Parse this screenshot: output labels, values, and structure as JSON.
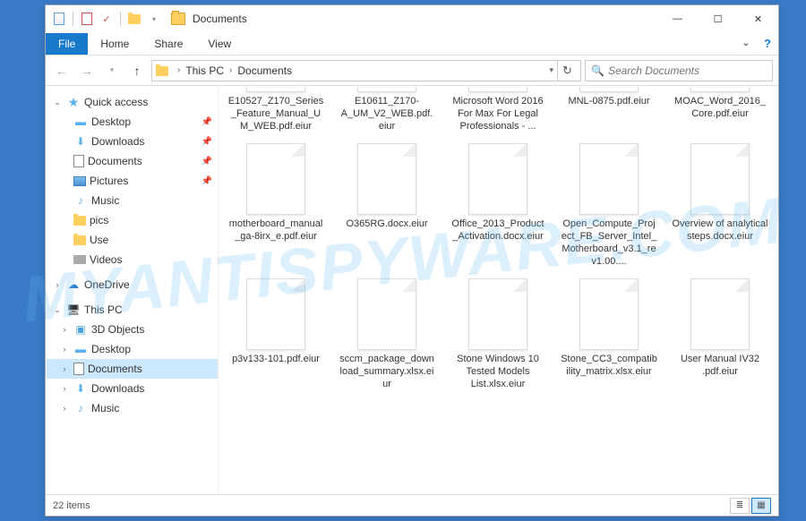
{
  "window": {
    "title": "Documents"
  },
  "ribbon": {
    "file": "File",
    "tabs": [
      "Home",
      "Share",
      "View"
    ]
  },
  "breadcrumb": {
    "root": "This PC",
    "current": "Documents"
  },
  "search": {
    "placeholder": "Search Documents"
  },
  "sidebar": {
    "quick_access": {
      "label": "Quick access",
      "items": [
        {
          "label": "Desktop",
          "pinned": true
        },
        {
          "label": "Downloads",
          "pinned": true
        },
        {
          "label": "Documents",
          "pinned": true
        },
        {
          "label": "Pictures",
          "pinned": true
        },
        {
          "label": "Music",
          "pinned": false
        },
        {
          "label": "pics",
          "pinned": false
        },
        {
          "label": "Use",
          "pinned": false
        },
        {
          "label": "Videos",
          "pinned": false
        }
      ]
    },
    "onedrive": {
      "label": "OneDrive"
    },
    "this_pc": {
      "label": "This PC",
      "items": [
        {
          "label": "3D Objects"
        },
        {
          "label": "Desktop"
        },
        {
          "label": "Documents"
        },
        {
          "label": "Downloads"
        },
        {
          "label": "Music"
        }
      ]
    }
  },
  "files": [
    {
      "name": "E10527_Z170_Series_Feature_Manual_UM_WEB.pdf.eiur",
      "row": 0
    },
    {
      "name": "E10611_Z170-A_UM_V2_WEB.pdf.eiur",
      "row": 0
    },
    {
      "name": "Microsoft Word 2016 For Max For Legal Professionals - ...",
      "row": 0
    },
    {
      "name": "MNL-0875.pdf.eiur",
      "row": 0
    },
    {
      "name": "MOAC_Word_2016_Core.pdf.eiur",
      "row": 0
    },
    {
      "name": "motherboard_manual_ga-8irx_e.pdf.eiur",
      "row": 1
    },
    {
      "name": "O365RG.docx.eiur",
      "row": 1
    },
    {
      "name": "Office_2013_Product_Activation.docx.eiur",
      "row": 1
    },
    {
      "name": "Open_Compute_Project_FB_Server_Intel_Motherboard_v3.1_rev1.00....",
      "row": 1
    },
    {
      "name": "Overview of analytical steps.docx.eiur",
      "row": 1
    },
    {
      "name": "p3v133-101.pdf.eiur",
      "row": 2
    },
    {
      "name": "sccm_package_download_summary.xlsx.eiur",
      "row": 2
    },
    {
      "name": "Stone Windows 10 Tested Models List.xlsx.eiur",
      "row": 2
    },
    {
      "name": "Stone_CC3_compatibility_matrix.xlsx.eiur",
      "row": 2
    },
    {
      "name": "User Manual IV32 .pdf.eiur",
      "row": 2
    }
  ],
  "status": {
    "count": "22 items"
  },
  "watermark": "MYANTISPYWARE.COM"
}
